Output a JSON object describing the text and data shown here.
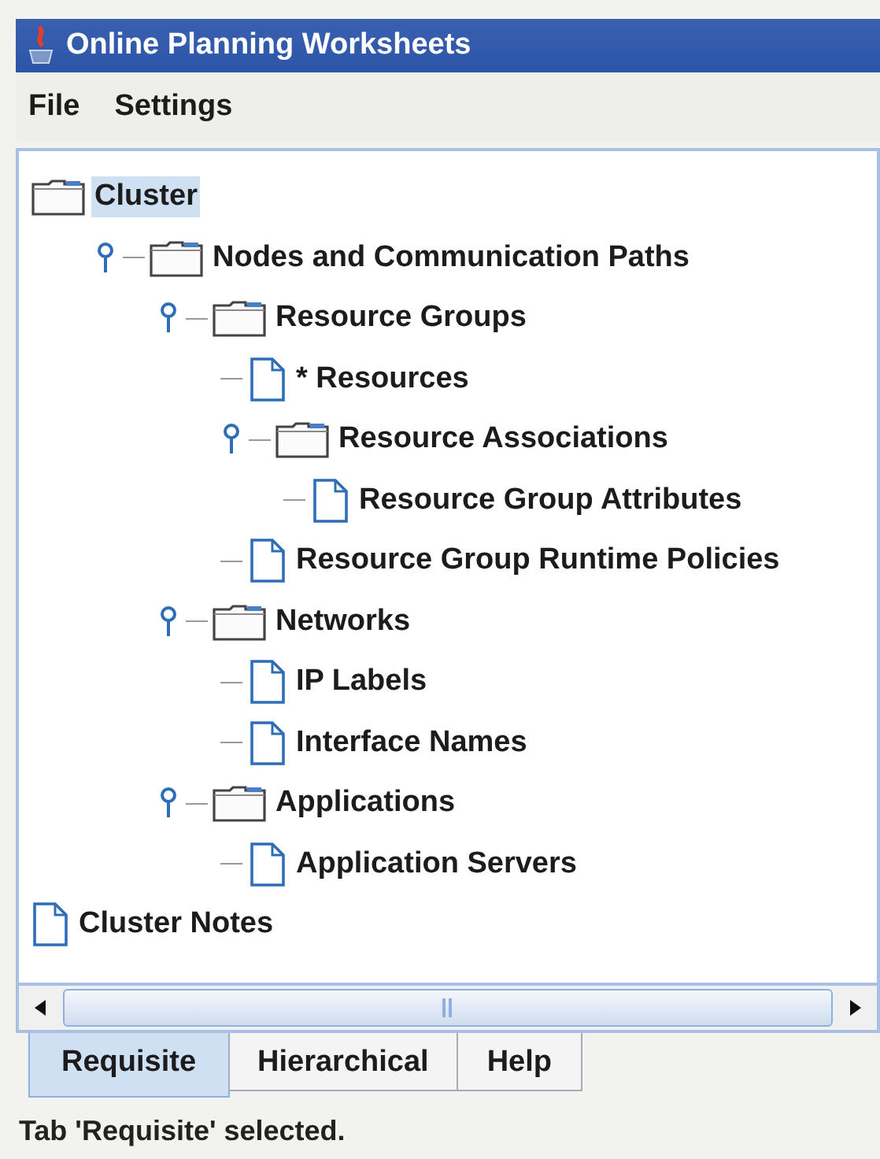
{
  "window": {
    "title": "Online Planning Worksheets"
  },
  "menu": [
    {
      "label": "File"
    },
    {
      "label": "Settings"
    }
  ],
  "tree": [
    {
      "label": "Cluster",
      "kind": "folder",
      "selected": true,
      "children": [
        {
          "label": "Nodes and Communication Paths",
          "kind": "folder",
          "expanded": true,
          "selected": false,
          "children": [
            {
              "label": "Resource Groups",
              "kind": "folder",
              "expanded": true,
              "selected": false,
              "children": [
                {
                  "label": "* Resources",
                  "kind": "document",
                  "selected": false
                },
                {
                  "label": "Resource Associations",
                  "kind": "folder",
                  "expanded": true,
                  "selected": false,
                  "children": [
                    {
                      "label": "Resource Group Attributes",
                      "kind": "document",
                      "selected": false
                    }
                  ]
                },
                {
                  "label": "Resource Group Runtime Policies",
                  "kind": "document",
                  "selected": false
                }
              ]
            },
            {
              "label": "Networks",
              "kind": "folder",
              "expanded": true,
              "selected": false,
              "children": [
                {
                  "label": "IP Labels",
                  "kind": "document",
                  "selected": false
                },
                {
                  "label": "Interface Names",
                  "kind": "document",
                  "selected": false
                }
              ]
            },
            {
              "label": "Applications",
              "kind": "folder",
              "expanded": true,
              "selected": false,
              "children": [
                {
                  "label": "Application Servers",
                  "kind": "document",
                  "selected": false
                }
              ]
            }
          ]
        }
      ]
    },
    {
      "label": "Cluster Notes",
      "kind": "document",
      "selected": false
    }
  ],
  "tabs": [
    {
      "label": "Requisite",
      "selected": true
    },
    {
      "label": "Hierarchical",
      "selected": false
    },
    {
      "label": "Help",
      "selected": false
    }
  ],
  "status_bar": "Tab 'Requisite' selected."
}
